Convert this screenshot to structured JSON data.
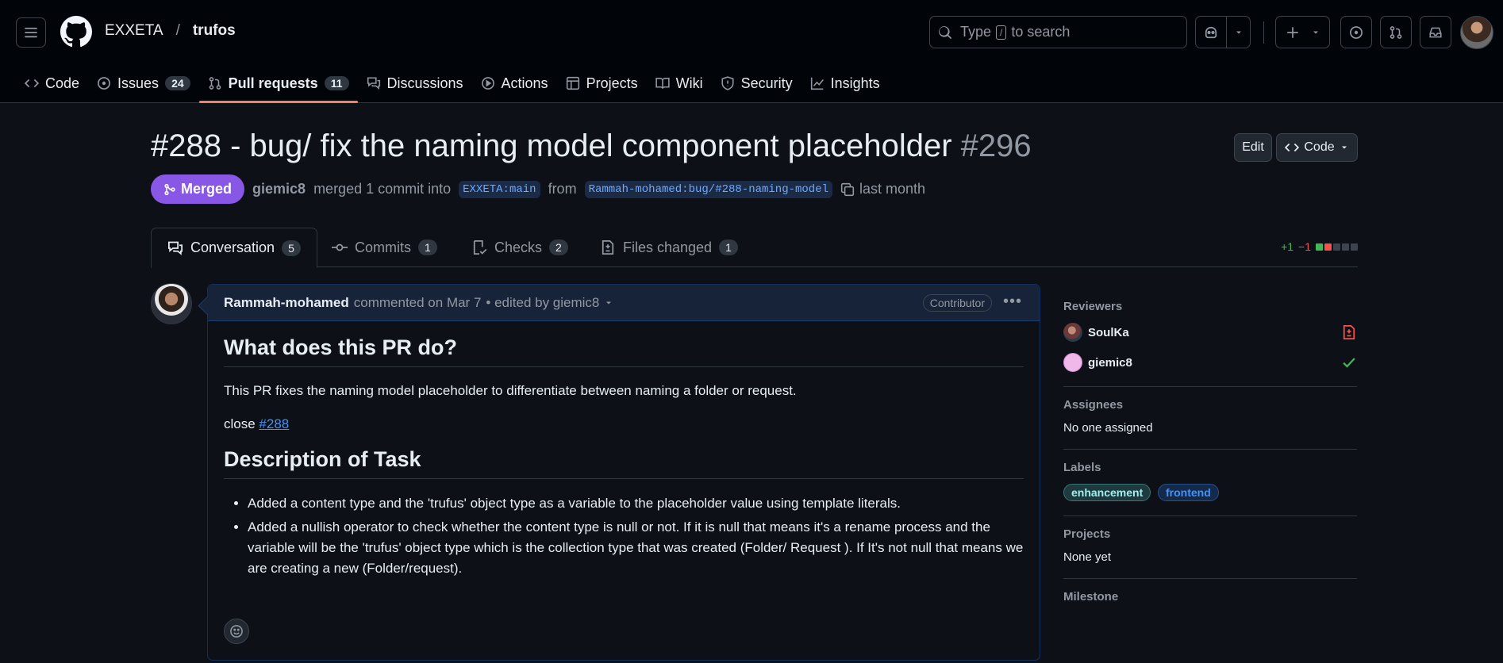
{
  "header": {
    "owner": "EXXETA",
    "separator": "/",
    "repo": "trufos",
    "search_prefix": "Type",
    "search_key": "/",
    "search_suffix": "to search"
  },
  "repo_tabs": [
    {
      "label": "Code",
      "icon": "code-icon"
    },
    {
      "label": "Issues",
      "icon": "issue-icon",
      "count": "24"
    },
    {
      "label": "Pull requests",
      "icon": "pull-request-icon",
      "count": "11",
      "active": true
    },
    {
      "label": "Discussions",
      "icon": "comment-discussion-icon"
    },
    {
      "label": "Actions",
      "icon": "play-icon"
    },
    {
      "label": "Projects",
      "icon": "table-icon"
    },
    {
      "label": "Wiki",
      "icon": "book-icon"
    },
    {
      "label": "Security",
      "icon": "shield-icon"
    },
    {
      "label": "Insights",
      "icon": "graph-icon"
    }
  ],
  "pr": {
    "title": "#288 - bug/ fix the naming model component placeholder",
    "number": "#296",
    "edit_label": "Edit",
    "code_label": "Code",
    "state_label": "Merged",
    "author": "giemic8",
    "merge_text": "merged 1 commit into",
    "base_branch": "EXXETA:main",
    "from_text": "from",
    "head_branch": "Rammah-mohamed:bug/#288-naming-model",
    "time": "last month"
  },
  "pr_tabs": [
    {
      "label": "Conversation",
      "count": "5"
    },
    {
      "label": "Commits",
      "count": "1"
    },
    {
      "label": "Checks",
      "count": "2"
    },
    {
      "label": "Files changed",
      "count": "1"
    }
  ],
  "diffstat": {
    "additions": "+1",
    "deletions": "−1"
  },
  "comment": {
    "author": "Rammah-mohamed",
    "action": "commented on Mar 7",
    "edited": "• edited by giemic8",
    "role": "Contributor",
    "heading1": "What does this PR do?",
    "para1": "This PR fixes the naming model placeholder to differentiate between naming a folder or request.",
    "close_text": "close",
    "close_link": "#288",
    "heading2": "Description of Task",
    "bullets": [
      "Added a content type and the 'trufus' object type as a variable to the placeholder value using template literals.",
      "Added a nullish operator to check whether the content type is null or not. If it is null that means it's a rename process and the variable will be the 'trufus' object type which is the collection type that was created (Folder/ Request ). If It's not null that means we are creating a new (Folder/request)."
    ]
  },
  "sidebar": {
    "reviewers_title": "Reviewers",
    "reviewers": [
      {
        "name": "SoulKa",
        "status": "file-diff-icon"
      },
      {
        "name": "giemic8",
        "status": "check-icon"
      }
    ],
    "assignees_title": "Assignees",
    "assignees_value": "No one assigned",
    "labels_title": "Labels",
    "labels": [
      {
        "name": "enhancement",
        "color": "#a2eeef"
      },
      {
        "name": "frontend",
        "color": "#4493f8"
      }
    ],
    "projects_title": "Projects",
    "projects_value": "None yet",
    "milestone_title": "Milestone"
  },
  "colors": {
    "accent": "#f78166",
    "merged": "#8957e5",
    "link": "#4493f8",
    "success": "#3fb950",
    "danger": "#f85149"
  }
}
